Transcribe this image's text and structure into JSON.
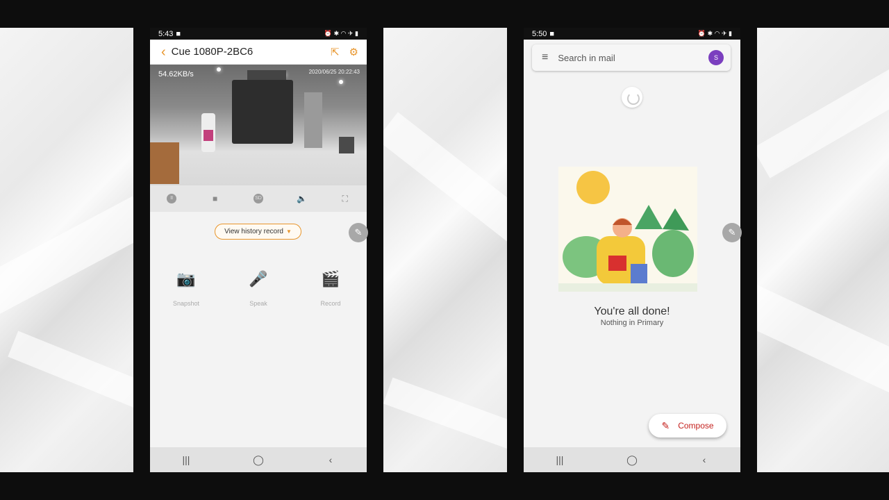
{
  "phone1": {
    "status": {
      "time": "5:43",
      "icons": "⏰ ✱ ◠ ✈ ▮"
    },
    "header": {
      "title": "Cue 1080P-2BC6",
      "back_icon": "‹",
      "share_icon": "⇱",
      "settings_icon": "⚙"
    },
    "video": {
      "speed": "54.62KB/s",
      "timestamp": "2020/06/25 20:22:43"
    },
    "controls": [
      {
        "name": "pause-icon",
        "glyph": "II"
      },
      {
        "name": "stop-icon",
        "glyph": "■"
      },
      {
        "name": "sd-quality-icon",
        "glyph": "SD"
      },
      {
        "name": "mute-icon",
        "glyph": "🔈"
      },
      {
        "name": "fullscreen-icon",
        "glyph": "⛶"
      }
    ],
    "history_button": "View history record",
    "actions": [
      {
        "label": "Snapshot",
        "icon": "📷"
      },
      {
        "label": "Speak",
        "icon": "🎤"
      },
      {
        "label": "Record",
        "icon": "🎬"
      }
    ],
    "accent_color": "#e8952b"
  },
  "phone2": {
    "status": {
      "time": "5:50",
      "icons": "⏰ ✱ ◠ ✈ ▮"
    },
    "search": {
      "placeholder": "Search in mail",
      "avatar_initial": "S"
    },
    "empty_state": {
      "title": "You're all done!",
      "subtitle": "Nothing in Primary"
    },
    "compose": "Compose",
    "accent_color": "#c5221f"
  },
  "navbar": {
    "recents": "|||",
    "home": "◯",
    "back": "‹"
  }
}
